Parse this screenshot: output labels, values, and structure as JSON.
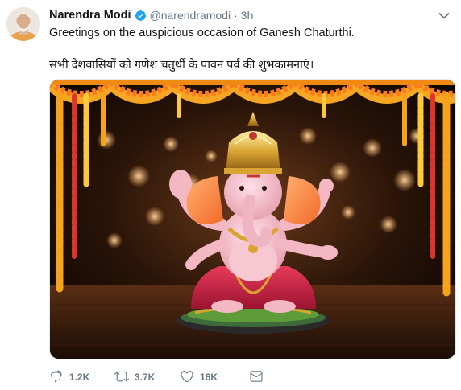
{
  "author": {
    "name": "Narendra Modi",
    "handle": "@narendramodi",
    "separator": "·",
    "time": "3h"
  },
  "tweet": {
    "text_en": "Greetings on the auspicious occasion of Ganesh Chaturthi.",
    "text_hi": "सभी देशवासियों को गणेश चतुर्थी के पावन पर्व की शुभकामनाएं।"
  },
  "actions": {
    "replies": "1.2K",
    "retweets": "3.7K",
    "likes": "16K"
  },
  "icons": {
    "verified": "verified-badge-icon",
    "caret": "chevron-down-icon",
    "reply": "reply-icon",
    "retweet": "retweet-icon",
    "like": "heart-icon",
    "dm": "envelope-icon"
  },
  "colors": {
    "text": "#14171a",
    "secondary": "#657786",
    "verified": "#1da1f2",
    "border": "#e1e8ed"
  }
}
